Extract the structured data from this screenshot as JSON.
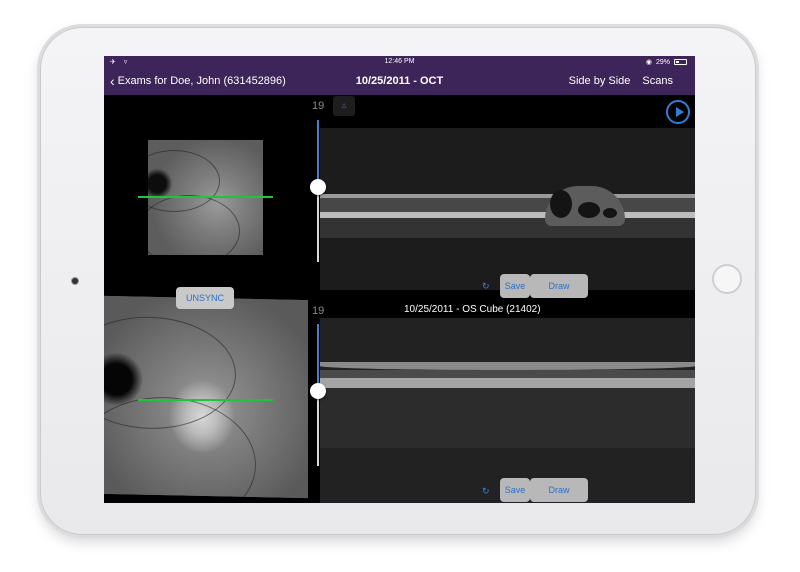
{
  "status_bar": {
    "left_icons": "✈ ▿",
    "time": "12:46 PM",
    "battery_percent": "29%"
  },
  "nav": {
    "back_label": "Exams for Doe, John (631452896)",
    "back_chevron": "‹",
    "title": "10/25/2011 - OCT",
    "side_by_side_label": "Side by Side",
    "scans_label": "Scans"
  },
  "viewer_top": {
    "scan_number": "19",
    "slice_fraction": 0.47,
    "save_label": "Save",
    "draw_label": "Draw"
  },
  "viewer_bottom": {
    "scan_number": "19",
    "slice_fraction": 0.47,
    "caption": "10/25/2011 - OS Cube (21402)",
    "unsync_label": "UNSYNC",
    "save_label": "Save",
    "draw_label": "Draw"
  },
  "icons": {
    "play": "play-icon",
    "refresh": "refresh-icon",
    "back": "chevron-left-icon",
    "battery": "battery-icon",
    "airplane": "airplane-icon",
    "wifi": "wifi-icon"
  },
  "colors": {
    "nav_background": "#3d2459",
    "accent": "#2f7fd8",
    "scan_line": "#22c33a"
  }
}
